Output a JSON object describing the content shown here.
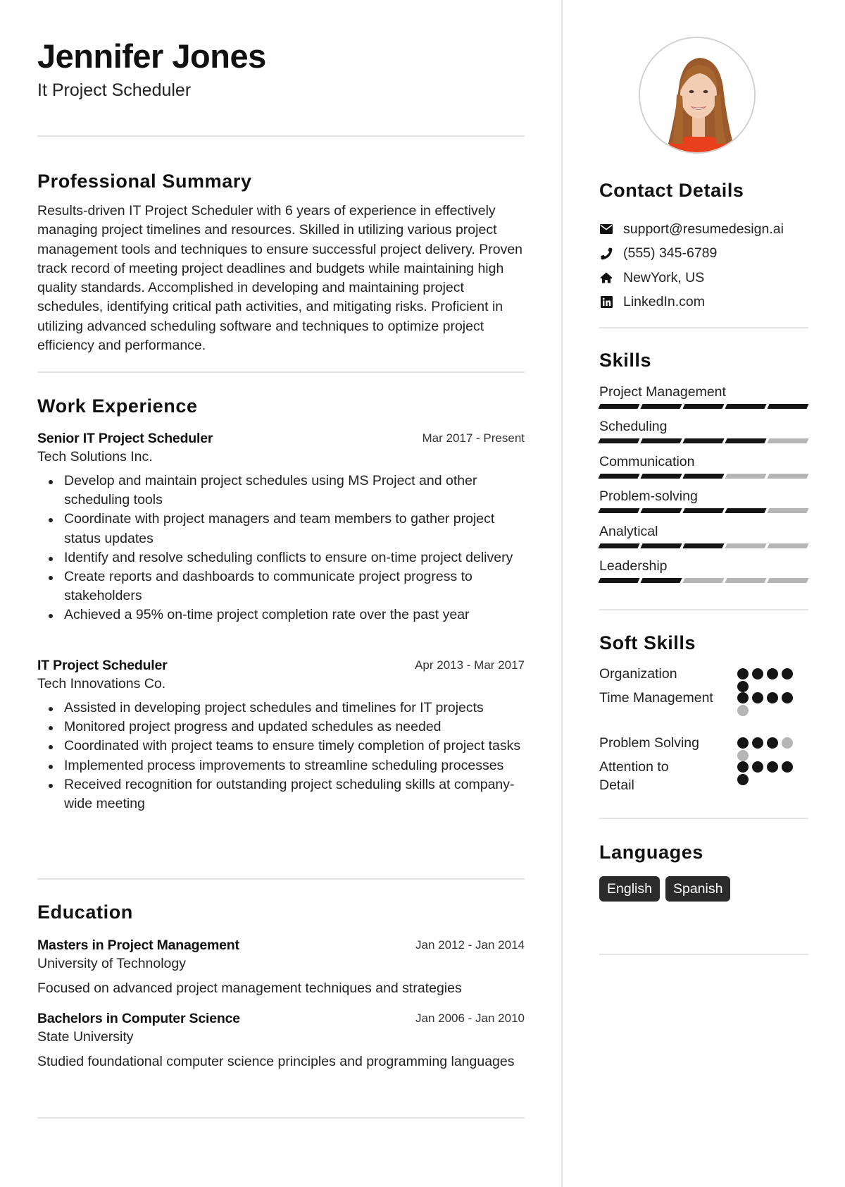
{
  "header": {
    "name": "Jennifer Jones",
    "role": "It Project Scheduler"
  },
  "summary": {
    "title": "Professional Summary",
    "text": "Results-driven IT Project Scheduler with 6 years of experience in effectively managing project timelines and resources. Skilled in utilizing various project management tools and techniques to ensure successful project delivery. Proven track record of meeting project deadlines and budgets while maintaining high quality standards. Accomplished in developing and maintaining project schedules, identifying critical path activities, and mitigating risks. Proficient in utilizing advanced scheduling software and techniques to optimize project efficiency and performance."
  },
  "experience": {
    "title": "Work Experience",
    "jobs": [
      {
        "title": "Senior IT Project Scheduler",
        "date": "Mar 2017 - Present",
        "company": "Tech Solutions Inc.",
        "bullets": [
          "Develop and maintain project schedules using MS Project and other scheduling tools",
          "Coordinate with project managers and team members to gather project status updates",
          "Identify and resolve scheduling conflicts to ensure on-time project delivery",
          "Create reports and dashboards to communicate project progress to stakeholders",
          "Achieved a 95% on-time project completion rate over the past year"
        ]
      },
      {
        "title": "IT Project Scheduler",
        "date": "Apr 2013 - Mar 2017",
        "company": "Tech Innovations Co.",
        "bullets": [
          "Assisted in developing project schedules and timelines for IT projects",
          "Monitored project progress and updated schedules as needed",
          "Coordinated with project teams to ensure timely completion of project tasks",
          "Implemented process improvements to streamline scheduling processes",
          "Received recognition for outstanding project scheduling skills at company-wide meeting"
        ]
      }
    ]
  },
  "education": {
    "title": "Education",
    "items": [
      {
        "degree": "Masters in Project Management",
        "date": "Jan 2012 - Jan 2014",
        "school": "University of Technology",
        "description": "Focused on advanced project management techniques and strategies"
      },
      {
        "degree": "Bachelors in Computer Science",
        "date": "Jan 2006 - Jan 2010",
        "school": "State University",
        "description": "Studied foundational computer science principles and programming languages"
      }
    ]
  },
  "contact": {
    "title": "Contact Details",
    "items": [
      {
        "icon": "envelope-icon",
        "text": "support@resumedesign.ai"
      },
      {
        "icon": "phone-icon",
        "text": "(555) 345-6789"
      },
      {
        "icon": "home-icon",
        "text": "NewYork, US"
      },
      {
        "icon": "linkedin-icon",
        "text": "LinkedIn.com"
      }
    ]
  },
  "skills": {
    "title": "Skills",
    "max": 5,
    "items": [
      {
        "name": "Project Management",
        "level": 5
      },
      {
        "name": "Scheduling",
        "level": 4
      },
      {
        "name": "Communication",
        "level": 3
      },
      {
        "name": "Problem-solving",
        "level": 4
      },
      {
        "name": "Analytical",
        "level": 3
      },
      {
        "name": "Leadership",
        "level": 2
      }
    ]
  },
  "soft_skills": {
    "title": "Soft Skills",
    "max": 5,
    "items": [
      {
        "name": "Organization",
        "level": 5
      },
      {
        "name": "Time Management",
        "level": 4
      },
      {
        "name": "Problem Solving",
        "level": 3
      },
      {
        "name": "Attention to Detail",
        "level": 5
      }
    ]
  },
  "languages": {
    "title": "Languages",
    "items": [
      "English",
      "Spanish"
    ]
  },
  "colors": {
    "text": "#1a1a1a",
    "filled": "#151515",
    "empty": "#b5b5b5",
    "divider": "#e4e4e4",
    "badge_bg": "#2b2b2b",
    "badge_text": "#ffffff"
  }
}
